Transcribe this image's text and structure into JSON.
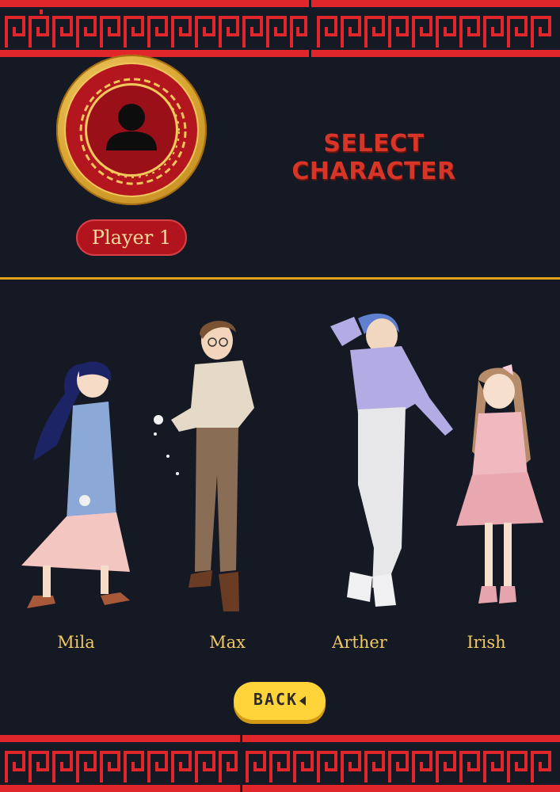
{
  "header": {
    "title": "SELECT CHARACTER"
  },
  "player": {
    "label": "Player 1",
    "avatar_icon": "user-silhouette-icon"
  },
  "characters": [
    {
      "name": "Mila"
    },
    {
      "name": "Max"
    },
    {
      "name": "Arther"
    },
    {
      "name": "Irish"
    }
  ],
  "back_button": {
    "label": "BACK",
    "icon": "triangle-left-icon"
  },
  "colors": {
    "background": "#151924",
    "border_red": "#e0252b",
    "divider_gold": "#e3a21e",
    "title_red": "#d63528",
    "name_gold": "#f1c863",
    "button_yellow": "#ffd43a"
  }
}
